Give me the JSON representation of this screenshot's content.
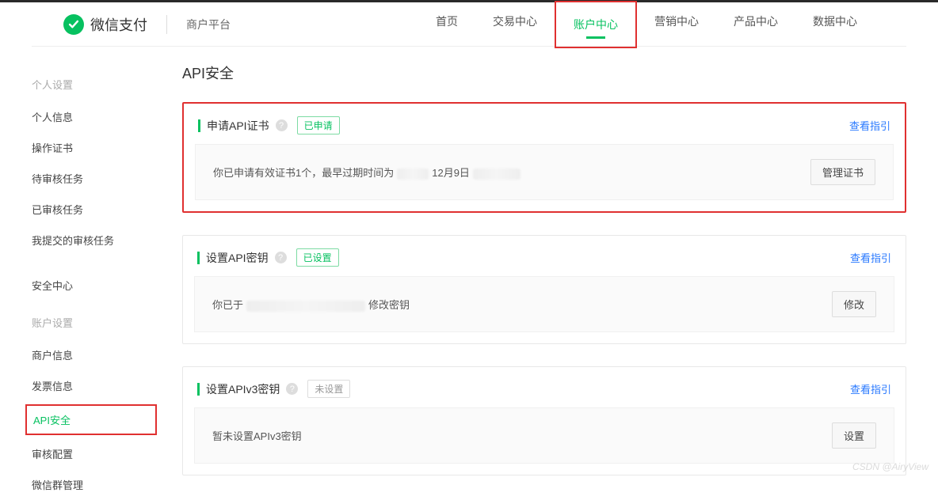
{
  "brand": {
    "name": "微信支付",
    "sub": "商户平台"
  },
  "nav": {
    "items": [
      "首页",
      "交易中心",
      "账户中心",
      "营销中心",
      "产品中心",
      "数据中心"
    ],
    "activeIndex": 2
  },
  "sidebar": {
    "group1_title": "个人设置",
    "group1_items": [
      "个人信息",
      "操作证书",
      "待审核任务",
      "已审核任务",
      "我提交的审核任务"
    ],
    "security_center": "安全中心",
    "group2_title": "账户设置",
    "group2_items": [
      "商户信息",
      "发票信息",
      "API安全",
      "审核配置",
      "微信群管理"
    ],
    "activeItem": "API安全"
  },
  "page": {
    "title": "API安全"
  },
  "card1": {
    "title": "申请API证书",
    "badge": "已申请",
    "guide": "查看指引",
    "body_prefix": "你已申请有效证书1个，最早过期时间为",
    "body_mid": "12月9日",
    "button": "管理证书"
  },
  "card2": {
    "title": "设置API密钥",
    "badge": "已设置",
    "guide": "查看指引",
    "body_prefix": "你已于",
    "body_suffix": "修改密钥",
    "button": "修改"
  },
  "card3": {
    "title": "设置APIv3密钥",
    "badge": "未设置",
    "guide": "查看指引",
    "body": "暂未设置APIv3密钥",
    "button": "设置"
  },
  "watermark": "CSDN @AiryView"
}
